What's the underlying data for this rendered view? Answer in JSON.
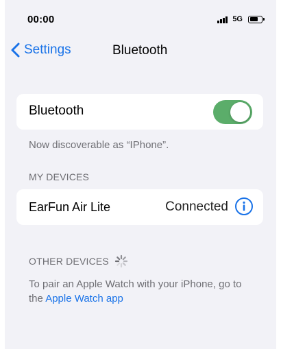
{
  "status_bar": {
    "time": "00:00",
    "network": "5G"
  },
  "nav": {
    "back_label": "Settings",
    "title": "Bluetooth"
  },
  "bluetooth": {
    "label": "Bluetooth",
    "enabled": true,
    "discoverable_text": "Now discoverable as “IPhone”."
  },
  "my_devices": {
    "header": "MY DEVICES",
    "items": [
      {
        "name": "EarFun Air Lite",
        "status": "Connected"
      }
    ]
  },
  "other_devices": {
    "header": "OTHER DEVICES",
    "hint_text": "To pair an Apple Watch with your iPhone, go to the ",
    "hint_link": "Apple Watch app"
  },
  "colors": {
    "accent": "#1a73e8",
    "toggle_on": "#5bad6a",
    "background": "#f2f2f7"
  },
  "icons": [
    "signal-icon",
    "battery-icon",
    "chevron-left-icon",
    "info-icon",
    "spinner-icon"
  ]
}
